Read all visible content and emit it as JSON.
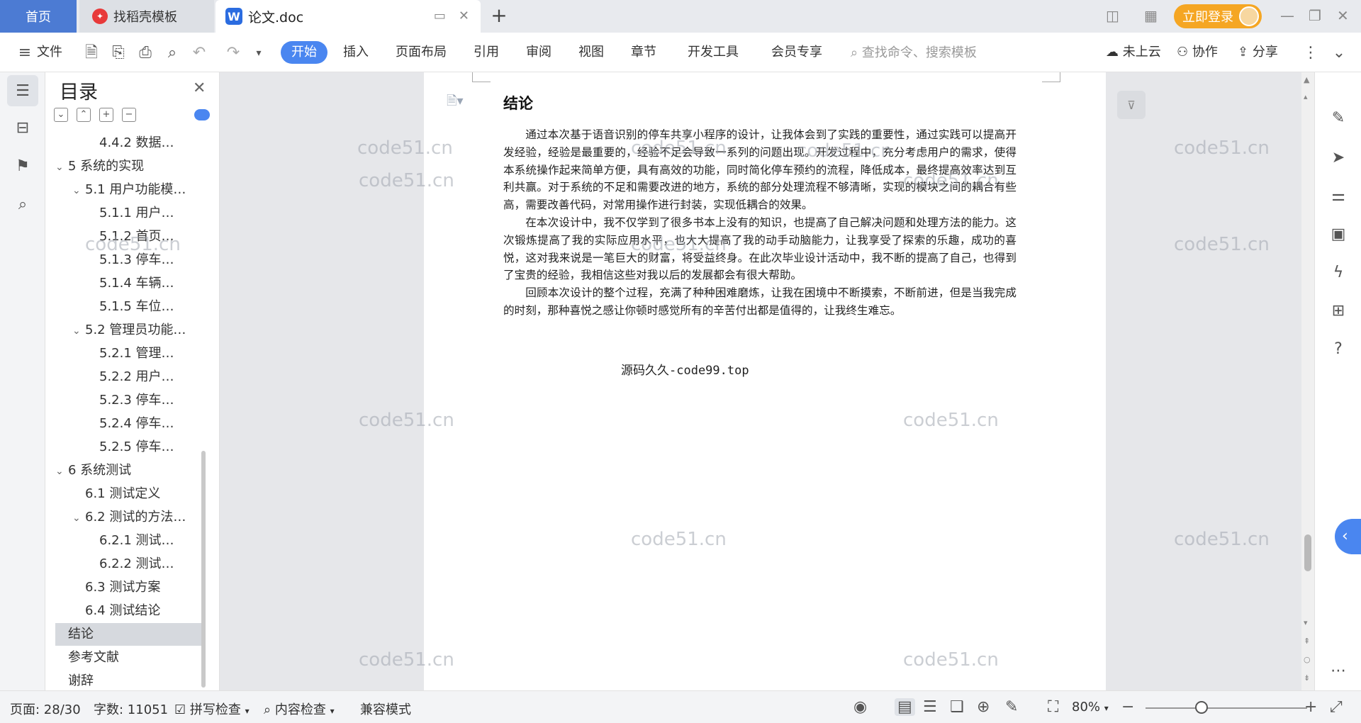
{
  "tabs": {
    "home": "首页",
    "daoke": "找稻壳模板",
    "doc": "论文.doc",
    "add": "+"
  },
  "topbar": {
    "login": "立即登录"
  },
  "ribbon": {
    "file": "文件",
    "start": "开始",
    "insert": "插入",
    "layout": "页面布局",
    "reference": "引用",
    "review": "审阅",
    "view": "视图",
    "chapter": "章节",
    "devtools": "开发工具",
    "member": "会员专享",
    "search_placeholder": "查找命令、搜索模板",
    "cloud": "未上云",
    "collab": "协作",
    "share": "分享"
  },
  "toc": {
    "title": "目录",
    "items": [
      {
        "label": "4.4.2 数据…",
        "indent": 2
      },
      {
        "label": "5 系统的实现",
        "indent": 0,
        "caret": true
      },
      {
        "label": "5.1 用户功能模…",
        "indent": 1,
        "caret": true
      },
      {
        "label": "5.1.1 用户…",
        "indent": 2
      },
      {
        "label": "5.1.2 首页…",
        "indent": 2
      },
      {
        "label": "5.1.3 停车…",
        "indent": 2
      },
      {
        "label": "5.1.4 车辆…",
        "indent": 2
      },
      {
        "label": "5.1.5 车位…",
        "indent": 2
      },
      {
        "label": "5.2 管理员功能…",
        "indent": 1,
        "caret": true
      },
      {
        "label": "5.2.1 管理…",
        "indent": 2
      },
      {
        "label": "5.2.2 用户…",
        "indent": 2
      },
      {
        "label": "5.2.3 停车…",
        "indent": 2
      },
      {
        "label": "5.2.4 停车…",
        "indent": 2
      },
      {
        "label": "5.2.5 停车…",
        "indent": 2
      },
      {
        "label": "6 系统测试",
        "indent": 0,
        "caret": true
      },
      {
        "label": "6.1 测试定义",
        "indent": 1
      },
      {
        "label": "6.2 测试的方法…",
        "indent": 1,
        "caret": true
      },
      {
        "label": "6.2.1 测试…",
        "indent": 2
      },
      {
        "label": "6.2.2 测试…",
        "indent": 2
      },
      {
        "label": "6.3 测试方案",
        "indent": 1
      },
      {
        "label": "6.4 测试结论",
        "indent": 1
      },
      {
        "label": "结论",
        "indent": 0,
        "selected": true
      },
      {
        "label": "参考文献",
        "indent": 0
      },
      {
        "label": "谢辞",
        "indent": 0
      }
    ]
  },
  "document": {
    "heading": "结论",
    "paragraphs": [
      "通过本次基于语音识别的停车共享小程序的设计，让我体会到了实践的重要性，通过实践可以提高开发经验，经验是最重要的，经验不足会导致一系列的问题出现。开发过程中，充分考虑用户的需求，使得本系统操作起来简单方便，具有高效的功能，同时简化停车预约的流程，降低成本，最终提高效率达到互利共赢。对于系统的不足和需要改进的地方，系统的部分处理流程不够清晰，实现的模块之间的耦合有些高，需要改善代码，对常用操作进行封装，实现低耦合的效果。",
      "在本次设计中，我不仅学到了很多书本上没有的知识，也提高了自己解决问题和处理方法的能力。这次锻炼提高了我的实际应用水平，也大大提高了我的动手动脑能力，让我享受了探索的乐趣，成功的喜悦，这对我来说是一笔巨大的财富，将受益终身。在此次毕业设计活动中，我不断的提高了自己，也得到了宝贵的经验，我相信这些对我以后的发展都会有很大帮助。",
      "回顾本次设计的整个过程，充满了种种困难磨炼，让我在困境中不断摸索，不断前进，但是当我完成的时刻，那种喜悦之感让你顿时感觉所有的辛苦付出都是值得的，让我终生难忘。"
    ],
    "footer": "源码久久-code99.top",
    "watermark": "code51.cn"
  },
  "status": {
    "page": "页面: 28/30",
    "words": "字数: 11051",
    "spell": "拼写检查",
    "content_check": "内容检查",
    "compat": "兼容模式",
    "zoom": "80%"
  }
}
